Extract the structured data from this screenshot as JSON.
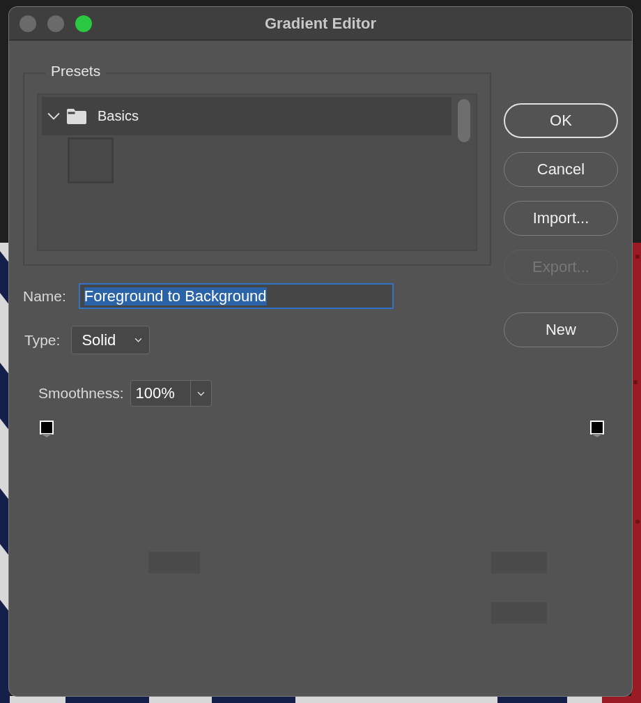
{
  "window": {
    "title": "Gradient Editor",
    "lights": [
      {
        "kind": "close",
        "active": false
      },
      {
        "kind": "minimize",
        "active": false
      },
      {
        "kind": "zoom",
        "active": true
      }
    ]
  },
  "presets": {
    "label": "Presets",
    "groups": [
      {
        "name": "Basics",
        "expanded": true,
        "swatches": [
          {
            "kind": "empty"
          }
        ]
      }
    ]
  },
  "buttons": [
    {
      "label": "OK",
      "default": true,
      "disabled": false
    },
    {
      "label": "Cancel",
      "default": false,
      "disabled": false
    },
    {
      "label": "Import...",
      "default": false,
      "disabled": false
    },
    {
      "label": "Export...",
      "default": false,
      "disabled": true
    }
  ],
  "new_button": {
    "label": "New"
  },
  "name": {
    "label": "Name:",
    "value": "Foreground to Background",
    "selected": true
  },
  "type": {
    "label": "Type:",
    "value": "Solid"
  },
  "smoothness": {
    "label": "Smoothness:",
    "value": "100%"
  },
  "gradient_stops": [
    {
      "kind": "opacity"
    },
    {
      "kind": "opacity"
    }
  ],
  "empty_fields": [
    {
      "disabled": true
    },
    {
      "disabled": true
    },
    {
      "disabled": true
    }
  ]
}
